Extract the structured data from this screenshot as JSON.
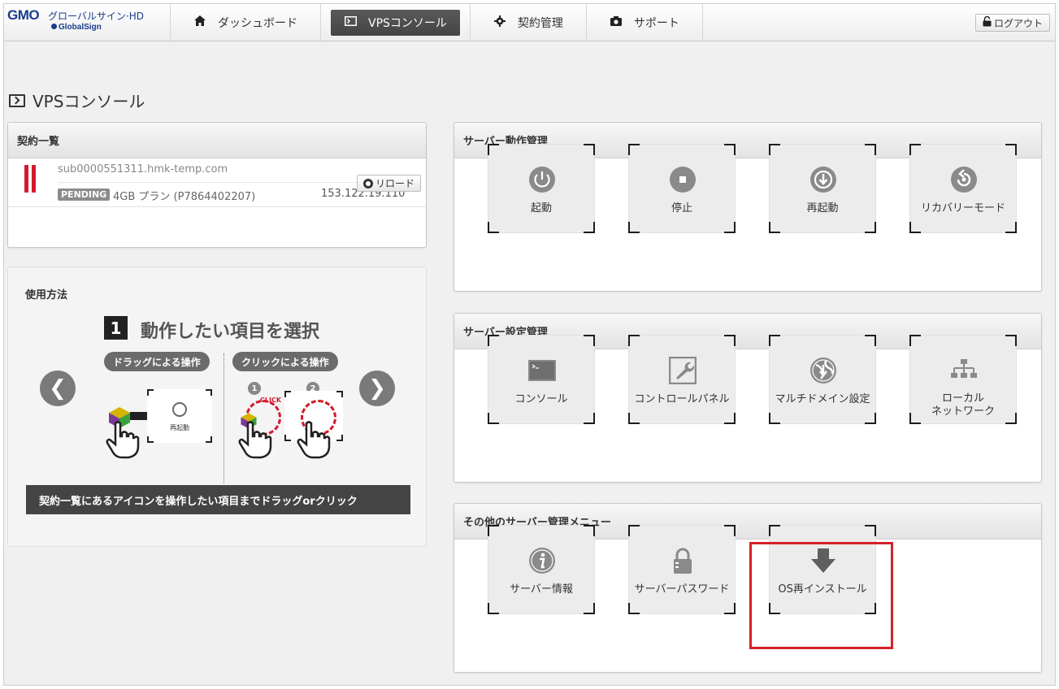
{
  "header": {
    "logo_gmo": "GMO",
    "logo_sub": "グローバルサイン·HD",
    "logo_globalsign": "GlobalSign",
    "nav": [
      {
        "label": "ダッシュボード",
        "icon": "home-icon"
      },
      {
        "label": "VPSコンソール",
        "icon": "terminal-icon",
        "active": true
      },
      {
        "label": "契約管理",
        "icon": "gear-icon"
      },
      {
        "label": "サポート",
        "icon": "camera-icon"
      }
    ],
    "logout_label": "ログアウト"
  },
  "page": {
    "title": "VPSコンソール"
  },
  "contracts": {
    "heading": "契約一覧",
    "items": [
      {
        "hostname": "sub0000551311.hmk-temp.com",
        "status": "PENDING",
        "plan": "4GB プラン (P7864402207)",
        "ip": "153.122.19.110"
      }
    ],
    "reload_label": "リロード"
  },
  "usage": {
    "heading": "使用方法",
    "step_number": "1",
    "step_text": "動作したい項目を選択",
    "drag_tag": "ドラッグによる操作",
    "click_tag": "クリックによる操作",
    "demo_label": "再起動",
    "click_word": "CLICK",
    "num1": "1",
    "num2": "2",
    "prev_glyph": "❮",
    "next_glyph": "❯",
    "caption": "契約一覧にあるアイコンを操作したい項目までドラッグorクリック"
  },
  "server_ops": {
    "heading": "サーバー動作管理",
    "tiles": [
      {
        "label": "起動",
        "icon": "power-icon"
      },
      {
        "label": "停止",
        "icon": "stop-icon"
      },
      {
        "label": "再起動",
        "icon": "restart-icon"
      },
      {
        "label": "リカバリーモード",
        "icon": "recovery-icon"
      }
    ]
  },
  "server_settings": {
    "heading": "サーバー設定管理",
    "tiles": [
      {
        "label": "コンソール",
        "icon": "console-icon"
      },
      {
        "label": "コントロールパネル",
        "icon": "wrench-icon"
      },
      {
        "label": "マルチドメイン設定",
        "icon": "globe-icon"
      },
      {
        "label_line1": "ローカル",
        "label_line2": "ネットワーク",
        "icon": "network-icon"
      }
    ]
  },
  "other_menu": {
    "heading": "その他のサーバー管理メニュー",
    "tiles": [
      {
        "label": "サーバー情報",
        "icon": "info-icon"
      },
      {
        "label": "サーバーパスワード",
        "icon": "lock-icon"
      },
      {
        "label": "OS再インストール",
        "icon": "download-arrow-icon",
        "highlighted": true
      }
    ]
  },
  "colors": {
    "accent_red": "#d42128",
    "active_nav": "#4a4a4a",
    "brand_blue": "#1a3c8f"
  }
}
